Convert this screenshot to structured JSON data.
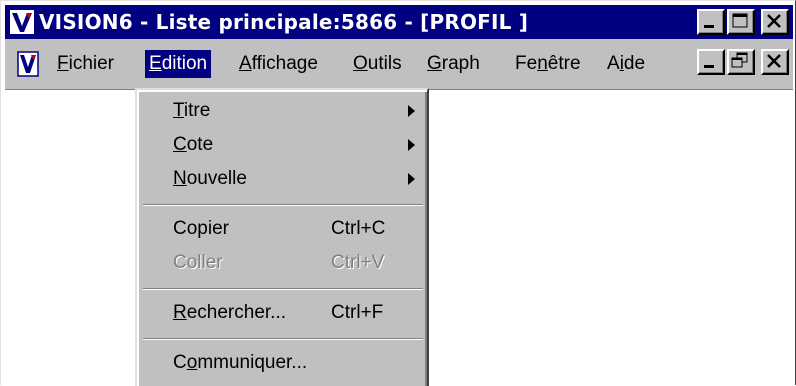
{
  "window": {
    "title": "VISION6 - Liste principale:5866 - [PROFIL ]",
    "buttons": {
      "minimize": "minimize-icon",
      "maximize": "maximize-icon",
      "close": "close-icon"
    }
  },
  "menubar": {
    "items": [
      {
        "label": "Fichier",
        "access_key": "F"
      },
      {
        "label": "Edition",
        "access_key": "E",
        "open": true
      },
      {
        "label": "Affichage",
        "access_key": "A"
      },
      {
        "label": "Outils",
        "access_key": "O"
      },
      {
        "label": "Graph",
        "access_key": "G"
      },
      {
        "label": "Fenêtre",
        "access_key": "n"
      },
      {
        "label": "Aide",
        "access_key": "i"
      }
    ],
    "child_buttons": {
      "minimize": "minimize-icon",
      "restore": "restore-icon",
      "close": "close-icon"
    }
  },
  "edit_menu": {
    "items": [
      {
        "label": "Titre",
        "access_key": "T",
        "submenu": true
      },
      {
        "label": "Cote",
        "access_key": "C",
        "submenu": true
      },
      {
        "label": "Nouvelle",
        "access_key": "N",
        "submenu": true
      },
      {
        "label": "Copier",
        "shortcut": "Ctrl+C"
      },
      {
        "label": "Coller",
        "shortcut": "Ctrl+V",
        "disabled": true
      },
      {
        "label": "Rechercher...",
        "access_key": "R",
        "shortcut": "Ctrl+F"
      },
      {
        "label": "Communiquer...",
        "access_key": "o"
      }
    ]
  },
  "colors": {
    "title_bar": "#000080",
    "face": "#c0c0c0",
    "highlight": "#000080",
    "disabled_text": "#808080"
  }
}
